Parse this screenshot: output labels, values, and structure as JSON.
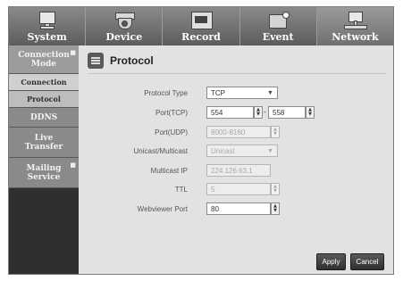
{
  "tabs": [
    {
      "label": "System",
      "icon": "monitor-icon"
    },
    {
      "label": "Device",
      "icon": "camera-icon"
    },
    {
      "label": "Record",
      "icon": "record-icon"
    },
    {
      "label": "Event",
      "icon": "event-icon"
    },
    {
      "label": "Network",
      "icon": "network-icon"
    }
  ],
  "sidebar": {
    "header": "Connection Mode",
    "items": [
      "Connection",
      "Protocol",
      "DDNS",
      "Live Transfer",
      "Mailing Service"
    ]
  },
  "page": {
    "title": "Protocol"
  },
  "form": {
    "protocol_type": {
      "label": "Protocol Type",
      "value": "TCP"
    },
    "port_tcp": {
      "label": "Port(TCP)",
      "from": "554",
      "to": "558"
    },
    "port_udp": {
      "label": "Port(UDP)",
      "value": "8000-8160"
    },
    "unicast_multicast": {
      "label": "Unicast/Multicast",
      "value": "Unicast"
    },
    "multicast_ip": {
      "label": "Multicast IP",
      "value": "224.126.63.1"
    },
    "ttl": {
      "label": "TTL",
      "value": "5"
    },
    "webviewer_port": {
      "label": "Webviewer Port",
      "value": "80"
    }
  },
  "buttons": {
    "apply": "Apply",
    "cancel": "Cancel"
  },
  "colors": {
    "tab_bg": "#6e6e6e",
    "sidebar_bg": "#2f2f2f",
    "content_bg": "#e2e2e2",
    "button_bg": "#3a3a3a"
  }
}
